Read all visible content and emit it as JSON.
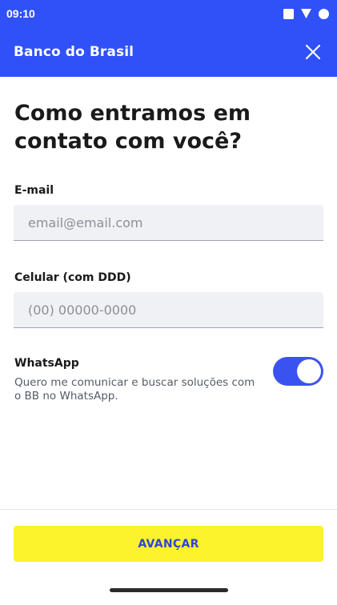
{
  "status_bar": {
    "time": "09:10",
    "icons": [
      "square-icon",
      "signal-icon",
      "battery-icon"
    ]
  },
  "app_bar": {
    "title": "Banco do Brasil",
    "close_icon": "close-icon",
    "color": "#2f51f7"
  },
  "heading": "Como entramos em contato com você?",
  "email": {
    "label": "E-mail",
    "value": "",
    "placeholder": "email@email.com"
  },
  "phone": {
    "label": "Celular (com DDD)",
    "value": "",
    "placeholder": "(00) 00000-0000"
  },
  "whatsapp": {
    "title": "WhatsApp",
    "description": "Quero me comunicar e buscar soluções com o BB no WhatsApp.",
    "enabled": true,
    "toggle_color": "#3a53f0"
  },
  "primary_button": {
    "label": "AVANÇAR",
    "background": "#fcf32c",
    "text_color": "#2f45d6"
  }
}
